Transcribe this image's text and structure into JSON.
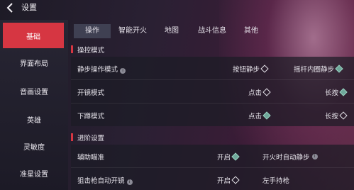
{
  "header": {
    "title": "设置"
  },
  "sidebar": {
    "items": [
      {
        "label": "基础"
      },
      {
        "label": "界面布局"
      },
      {
        "label": "音画设置"
      },
      {
        "label": "英雄"
      },
      {
        "label": "灵敏度"
      },
      {
        "label": "准星设置"
      }
    ]
  },
  "tabs": [
    {
      "label": "操作"
    },
    {
      "label": "智能开火"
    },
    {
      "label": "地图"
    },
    {
      "label": "战斗信息"
    },
    {
      "label": "其他"
    }
  ],
  "sections": {
    "control": {
      "title": "操控模式"
    },
    "advanced": {
      "title": "进阶设置"
    }
  },
  "rows": {
    "sneak": {
      "label": "静步操作模式",
      "opt1": "按钮静步",
      "opt2": "摇杆内圈静步"
    },
    "fire": {
      "label": "开镜模式",
      "opt1": "点击",
      "opt2": "长按"
    },
    "crouch": {
      "label": "下蹲模式",
      "opt1": "点击",
      "opt2": "长按"
    },
    "aim": {
      "label": "辅助瞄准",
      "opt1": "开启",
      "opt2": "开火时自动静步"
    },
    "sniper": {
      "label": "狙击枪自动开镜",
      "opt1": "开启",
      "opt2": "左手持枪"
    }
  },
  "colors": {
    "accent": "#d63642",
    "checked": "#6fa89b"
  }
}
